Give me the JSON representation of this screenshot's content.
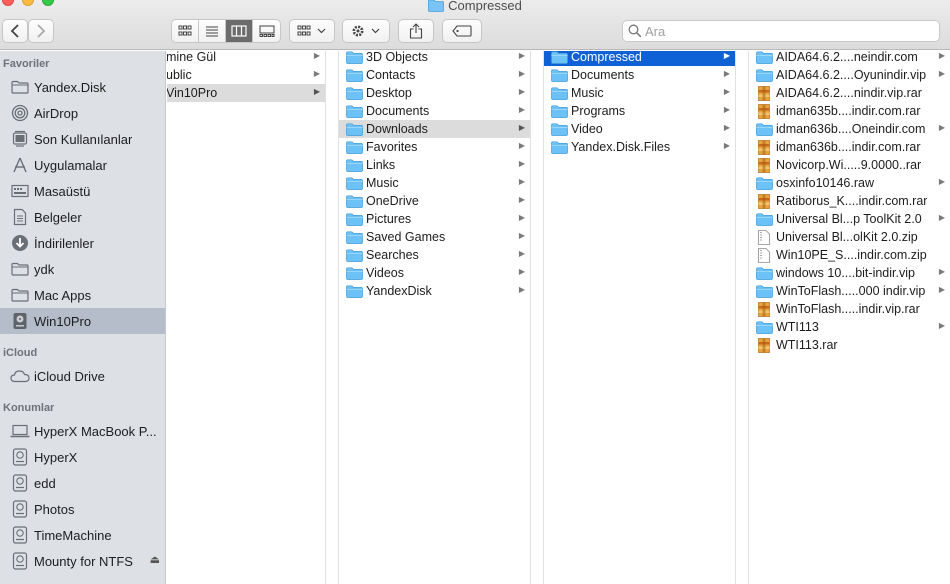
{
  "window": {
    "title": "Compressed"
  },
  "search": {
    "placeholder": "Ara"
  },
  "sidebar": {
    "favorites_header": "Favoriler",
    "favorites": [
      {
        "label": "Yandex.Disk",
        "icon": "folder-icon"
      },
      {
        "label": "AirDrop",
        "icon": "airdrop-icon"
      },
      {
        "label": "Son Kullanılanlar",
        "icon": "recents-icon"
      },
      {
        "label": "Uygulamalar",
        "icon": "applications-icon"
      },
      {
        "label": "Masaüstü",
        "icon": "desktop-icon"
      },
      {
        "label": "Belgeler",
        "icon": "documents-icon"
      },
      {
        "label": "İndirilenler",
        "icon": "downloads-icon"
      },
      {
        "label": "ydk",
        "icon": "folder-icon"
      },
      {
        "label": "Mac Apps",
        "icon": "folder-icon"
      },
      {
        "label": "Win10Pro",
        "icon": "drive-icon"
      }
    ],
    "icloud_header": "iCloud",
    "icloud": [
      {
        "label": "iCloud Drive",
        "icon": "cloud-icon"
      }
    ],
    "locations_header": "Konumlar",
    "locations": [
      {
        "label": "HyperX MacBook P...",
        "icon": "laptop-icon"
      },
      {
        "label": "HyperX",
        "icon": "drive-icon"
      },
      {
        "label": "edd",
        "icon": "drive-icon"
      },
      {
        "label": "Photos",
        "icon": "drive-icon"
      },
      {
        "label": "TimeMachine",
        "icon": "drive-icon"
      },
      {
        "label": "Mounty for NTFS",
        "icon": "drive-icon",
        "eject": "⏏"
      }
    ]
  },
  "columns": [
    {
      "items": [
        {
          "label": "mine Gül"
        },
        {
          "label": "ublic"
        },
        {
          "label": "Vin10Pro",
          "selected": "gray"
        }
      ]
    },
    {
      "items": [
        {
          "label": "3D Objects"
        },
        {
          "label": "Contacts"
        },
        {
          "label": "Desktop"
        },
        {
          "label": "Documents"
        },
        {
          "label": "Downloads",
          "selected": "gray"
        },
        {
          "label": "Favorites"
        },
        {
          "label": "Links"
        },
        {
          "label": "Music"
        },
        {
          "label": "OneDrive"
        },
        {
          "label": "Pictures"
        },
        {
          "label": "Saved Games"
        },
        {
          "label": "Searches"
        },
        {
          "label": "Videos"
        },
        {
          "label": "YandexDisk"
        }
      ]
    },
    {
      "items": [
        {
          "label": "Compressed",
          "selected": "blue"
        },
        {
          "label": "Documents"
        },
        {
          "label": "Music"
        },
        {
          "label": "Programs"
        },
        {
          "label": "Video"
        },
        {
          "label": "Yandex.Disk.Files"
        }
      ]
    },
    {
      "items": [
        {
          "label": "AIDA64.6.2....neindir.com",
          "type": "folder"
        },
        {
          "label": "AIDA64.6.2....Oyunindir.vip",
          "type": "folder"
        },
        {
          "label": "AIDA64.6.2....nindir.vip.rar",
          "type": "rar"
        },
        {
          "label": "idman635b....indir.com.rar",
          "type": "rar"
        },
        {
          "label": "idman636b....Oneindir.com",
          "type": "folder"
        },
        {
          "label": "idman636b....indir.com.rar",
          "type": "rar"
        },
        {
          "label": "Novicorp.Wi.....9.0000..rar",
          "type": "rar"
        },
        {
          "label": "osxinfo10146.raw",
          "type": "folder"
        },
        {
          "label": "Ratiborus_K....indir.com.rar",
          "type": "rar"
        },
        {
          "label": "Universal Bl...p ToolKit 2.0",
          "type": "folder"
        },
        {
          "label": "Universal Bl...olKit 2.0.zip",
          "type": "zip"
        },
        {
          "label": "Win10PE_S....indir.com.zip",
          "type": "zip"
        },
        {
          "label": "windows 10....bit-indir.vip",
          "type": "folder"
        },
        {
          "label": "WinToFlash.....000 indir.vip",
          "type": "folder"
        },
        {
          "label": "WinToFlash.....indir.vip.rar",
          "type": "rar"
        },
        {
          "label": "WTI113",
          "type": "folder"
        },
        {
          "label": "WTI113.rar",
          "type": "rar"
        }
      ]
    }
  ],
  "colors": {
    "selection_blue": "#0f62d6",
    "folder_blue": "#6cc1f7",
    "sidebar_bg": "#dde0e5"
  }
}
